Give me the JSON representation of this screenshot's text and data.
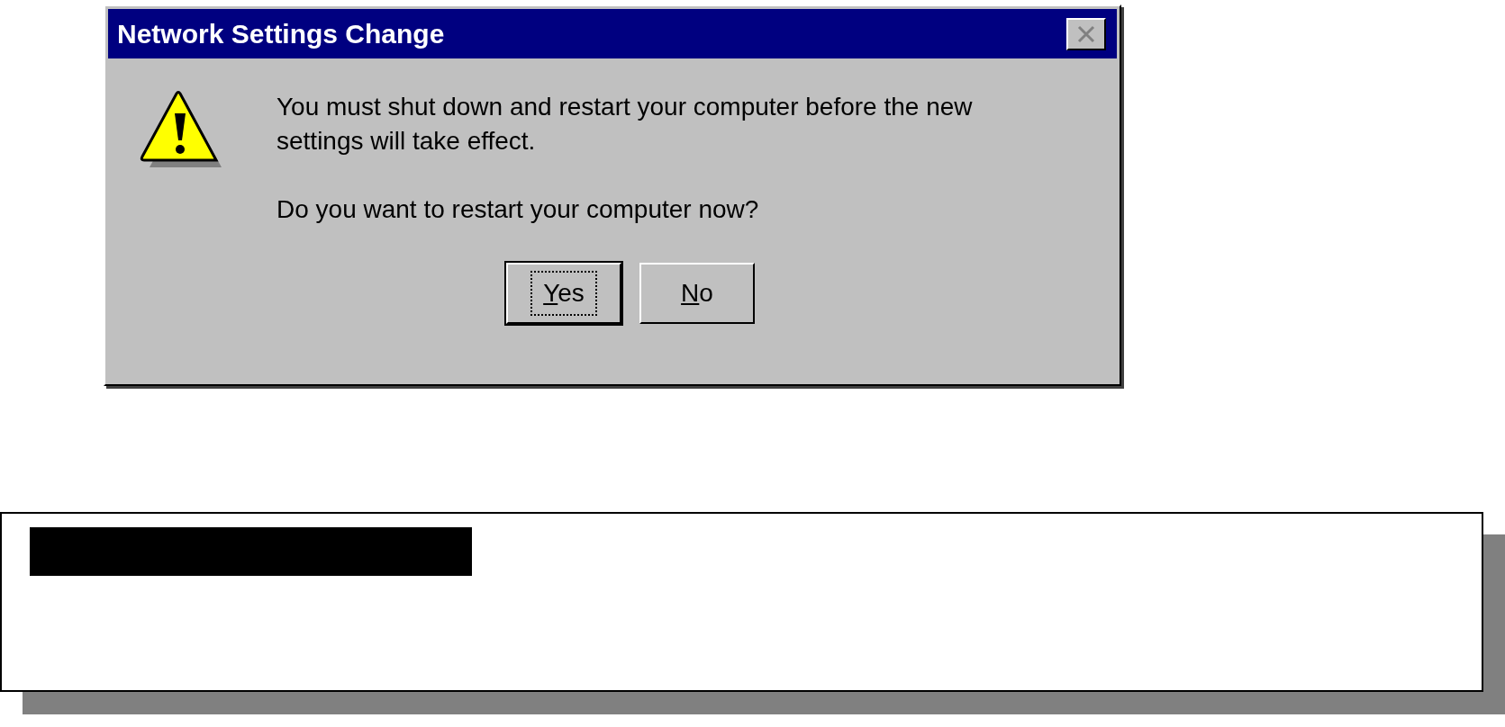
{
  "dialog": {
    "title": "Network Settings Change",
    "message": [
      "You must shut down and restart your computer before the new settings will take effect.",
      "Do you want to restart your computer now?"
    ],
    "buttons": [
      {
        "accelerator": "Y",
        "label_rest": "es",
        "default": true
      },
      {
        "accelerator": "N",
        "label_rest": "o",
        "default": false
      }
    ]
  },
  "note_box": {
    "heading_redacted": true
  }
}
